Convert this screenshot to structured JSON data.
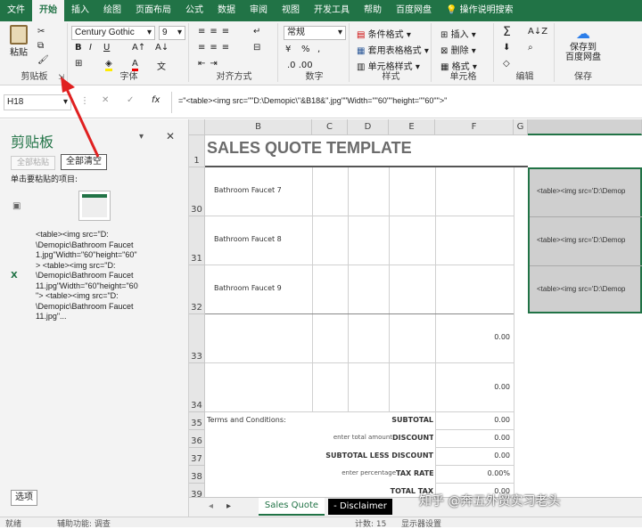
{
  "tabs": [
    "文件",
    "开始",
    "插入",
    "绘图",
    "页面布局",
    "公式",
    "数据",
    "审阅",
    "视图",
    "开发工具",
    "帮助",
    "百度网盘",
    "操作说明搜索"
  ],
  "ribbon": {
    "clipboard": {
      "paste": "粘贴",
      "label": "剪贴板"
    },
    "font": {
      "name": "Century Gothic",
      "size": "9",
      "bold": "B",
      "italic": "I",
      "underline": "U",
      "label": "字体"
    },
    "align": {
      "label": "对齐方式"
    },
    "number": {
      "format": "常规",
      "label": "数字"
    },
    "styles": {
      "cond": "条件格式",
      "table": "套用表格格式",
      "cell": "单元格样式",
      "label": "样式"
    },
    "cells": {
      "insert": "插入",
      "delete": "删除",
      "format": "格式",
      "label": "单元格"
    },
    "editing": {
      "label": "编辑"
    },
    "save": {
      "line1": "保存到",
      "line2": "百度网盘",
      "label": "保存"
    }
  },
  "formula_bar": {
    "name_box": "H18",
    "fx": "fx",
    "formula": "=\"<table><img src=\"\"D:\\Demopic\\\"&B18&\".jpg\"\"Width=\"\"60\"\"height=\"\"60\"\">\""
  },
  "clipboard_pane": {
    "title": "剪贴板",
    "paste_all": "全部粘贴",
    "clear_all": "全部清空",
    "hint": "单击要粘贴的项目:",
    "item2": [
      "<table><img src=\"D:",
      "\\Demopic\\Bathroom Faucet",
      "1.jpg\"Width=\"60\"height=\"60\"",
      "> <table><img src=\"D:",
      "\\Demopic\\Bathroom Faucet",
      "11.jpg\"Width=\"60\"height=\"60",
      "\"> <table><img src=\"D:",
      "\\Demopic\\Bathroom Faucet",
      "11.jpg\"..."
    ],
    "options": "选项"
  },
  "sheet": {
    "columns": [
      "B",
      "C",
      "D",
      "E",
      "F",
      "G"
    ],
    "title": "SALES QUOTE TEMPLATE",
    "rows": [
      {
        "num": "1"
      },
      {
        "num": "30",
        "desc": "Bathroom Faucet 7"
      },
      {
        "num": "31",
        "desc": "Bathroom Faucet 8"
      },
      {
        "num": "32",
        "desc": "Bathroom Faucet 9"
      },
      {
        "num": "33",
        "amt": "0.00"
      },
      {
        "num": "34",
        "amt": "0.00"
      },
      {
        "num": "35",
        "left": "Terms and Conditions:",
        "label": "SUBTOTAL",
        "amt": "0.00"
      },
      {
        "num": "36",
        "hint": "enter total amount",
        "label": "DISCOUNT",
        "amt": "0.00"
      },
      {
        "num": "37",
        "label": "SUBTOTAL LESS DISCOUNT",
        "amt": "0.00"
      },
      {
        "num": "38",
        "hint": "enter percentage",
        "label": "TAX RATE",
        "amt": "0.00%"
      },
      {
        "num": "39",
        "label": "TOTAL TAX",
        "amt": "0.00"
      }
    ],
    "h_cells": [
      "<table><img src='D:\\Demop",
      "<table><img src='D:\\Demop",
      "<table><img src='D:\\Demop"
    ],
    "sheet_tabs": [
      "Sales Quote",
      "- Disclaimer"
    ]
  },
  "status": {
    "ready": "就绪",
    "accessibility": "辅助功能: 调查",
    "count": "计数: 15",
    "display": "显示器设置"
  },
  "watermark": "知乎 @奔五外贸实习老头"
}
